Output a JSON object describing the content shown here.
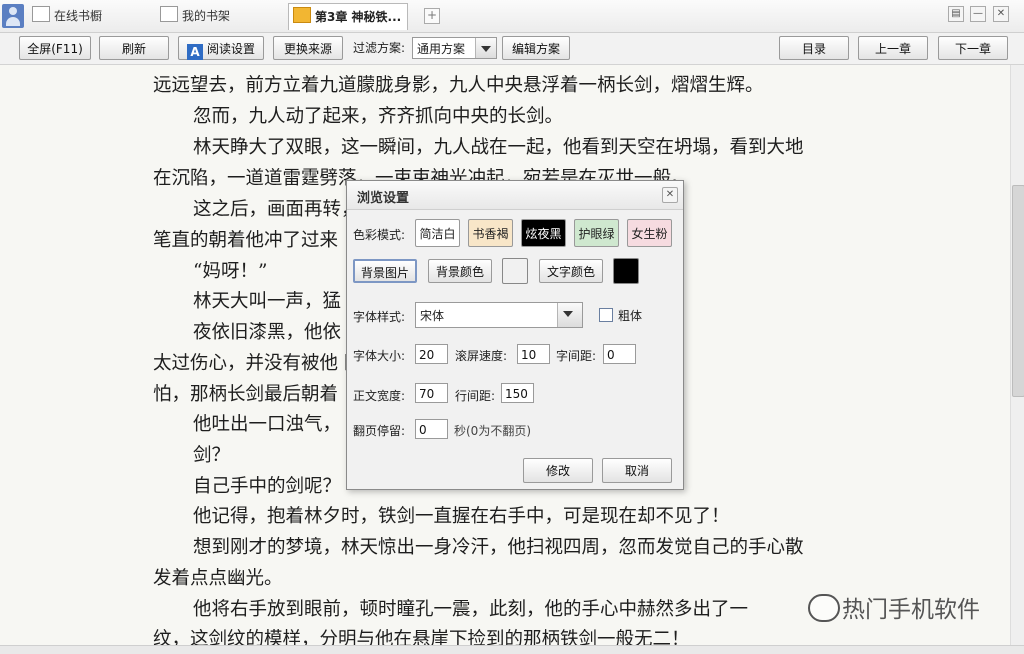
{
  "tabs": [
    {
      "label": "在线书橱"
    },
    {
      "label": "我的书架"
    },
    {
      "label": "第3章  神秘铁..."
    }
  ],
  "tab_add": "+",
  "window_controls": [
    "▤",
    "—",
    "✕"
  ],
  "toolbar": {
    "fullscreen": "全屏(F11)",
    "refresh": "刷新",
    "read_settings_icon": "A",
    "read_settings": "阅读设置",
    "change_source": "更换来源",
    "filter_label": "过滤方案:",
    "filter_value": "通用方案",
    "edit_scheme": "编辑方案",
    "toc": "目录",
    "prev": "上一章",
    "next": "下一章"
  },
  "content_lines": [
    "远远望去，前方立着九道朦胧身影，九人中央悬浮着一柄长剑，熠熠生辉。",
    "忽而，九人动了起来，齐齐抓向中央的长剑。",
    "林天睁大了双眼，这一瞬间，九人战在一起，他看到天空在坍塌，看到大地",
    "在沉陷，一道道雷霆劈落，一束束神光冲起，宛若是在灭世一般。",
    "这之后，画面再转，一重重模糊的壁垒，",
    "笔直的朝着他冲了过来",
    "“妈呀！”",
    "林天大叫一声，猛",
    "夜依旧漆黑，他依                                                    他怀中，或许是因为",
    "太过伤心，并没有被他                                        刚才的梦境太过可",
    "怕，那柄长剑最后朝着",
    "他吐出一口浊气，",
    "剑？",
    "自己手中的剑呢？",
    "他记得，抱着林夕时，铁剑一直握在右手中，可是现在却不见了！",
    "想到刚才的梦境，林天惊出一身冷汗，他扫视四周，忽而发觉自己的手心散",
    "发着点点幽光。",
    "他将右手放到眼前，顿时瞳孔一震，此刻，他的手心中赫然多出了一",
    "纹，这剑纹的模样，分明与他在悬崖下捡到的那柄铁剑一般无二！"
  ],
  "dialog": {
    "title": "浏览设置",
    "close": "✕",
    "color_mode_label": "色彩模式:",
    "schemes": [
      {
        "label": "简洁白",
        "bg": "#ffffff",
        "fg": "#222222"
      },
      {
        "label": "书香褐",
        "bg": "#f8e6c8",
        "fg": "#222222"
      },
      {
        "label": "炫夜黑",
        "bg": "#000000",
        "fg": "#ffffff"
      },
      {
        "label": "护眼绿",
        "bg": "#cfe8cf",
        "fg": "#222222"
      },
      {
        "label": "女生粉",
        "bg": "#f6dbe0",
        "fg": "#222222"
      }
    ],
    "bg_image": "背景图片",
    "bg_color": "背景颜色",
    "bg_color_value": "#f1f1f1",
    "text_color": "文字颜色",
    "text_color_value": "#000000",
    "font_style_label": "字体样式:",
    "font_style_value": "宋体",
    "bold_label": "粗体",
    "bold_checked": false,
    "font_size_label": "字体大小:",
    "font_size": "20",
    "scroll_speed_label": "滚屏速度:",
    "scroll_speed": "10",
    "char_spacing_label": "字间距:",
    "char_spacing": "0",
    "text_width_label": "正文宽度:",
    "text_width": "70",
    "line_spacing_label": "行间距:",
    "line_spacing": "150",
    "page_pause_label": "翻页停留:",
    "page_pause": "0",
    "page_pause_hint": "秒(0为不翻页)",
    "modify": "修改",
    "cancel": "取消"
  },
  "watermark": {
    "text": "热门手机软件"
  }
}
